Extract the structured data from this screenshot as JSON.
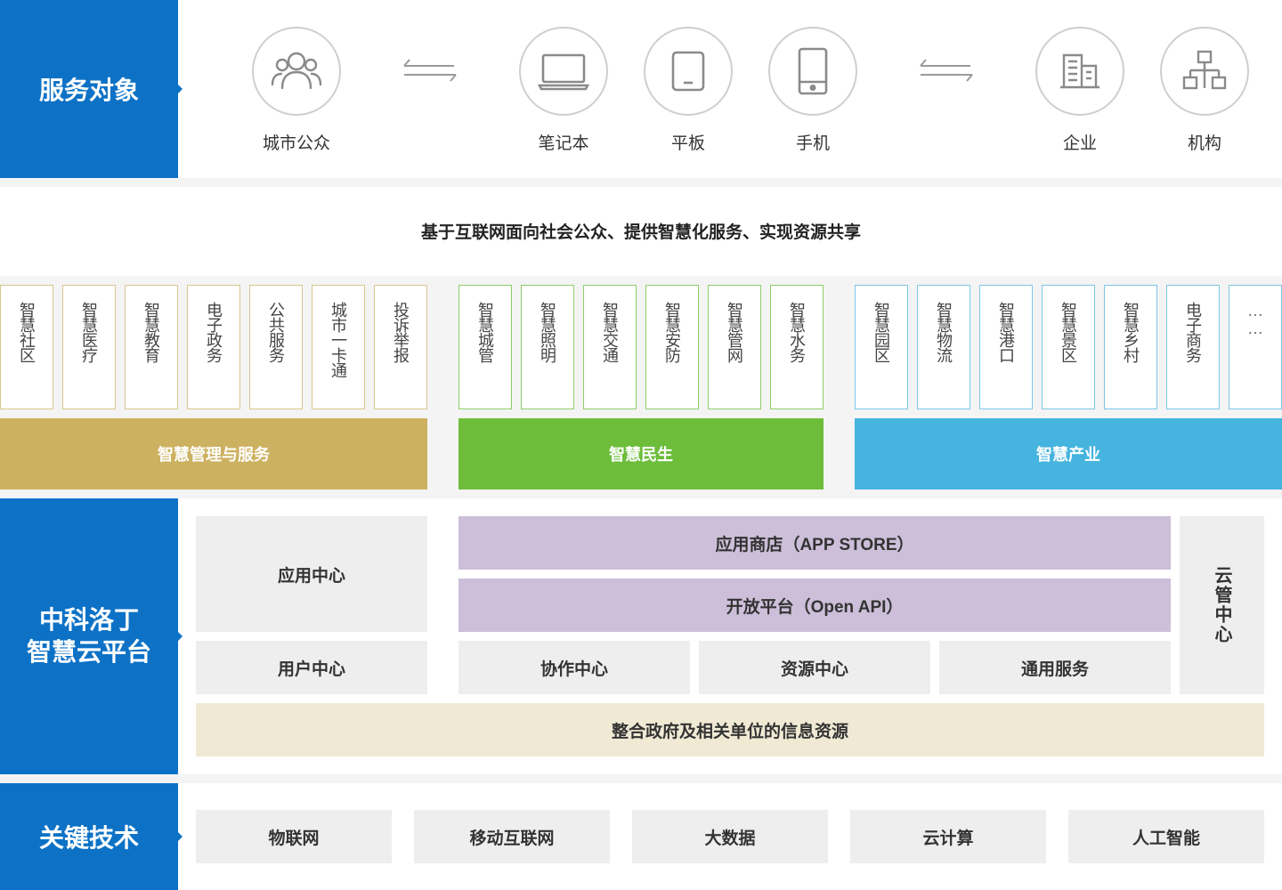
{
  "sections": {
    "service_objects": "服务对象",
    "platform": [
      "中科洛丁",
      "智慧云平台"
    ],
    "key_tech": "关键技术"
  },
  "service_targets": [
    {
      "label": "城市公众",
      "icon": "people-icon"
    },
    {
      "label": "笔记本",
      "icon": "laptop-icon"
    },
    {
      "label": "平板",
      "icon": "tablet-icon"
    },
    {
      "label": "手机",
      "icon": "phone-icon"
    },
    {
      "label": "企业",
      "icon": "building-icon"
    },
    {
      "label": "机构",
      "icon": "org-chart-icon"
    }
  ],
  "tagline": "基于互联网面向社会公众、提供智慧化服务、实现资源共享",
  "groups": [
    {
      "name": "智慧管理与服务",
      "color": "#ccb160",
      "border": "#d8c58a",
      "items": [
        "智慧社区",
        "智慧医疗",
        "智慧教育",
        "电子政务",
        "公共服务",
        "城市一卡通",
        "投诉举报"
      ]
    },
    {
      "name": "智慧民生",
      "color": "#6dbd3b",
      "border": "#8fcd6a",
      "items": [
        "智慧城管",
        "智慧照明",
        "智慧交通",
        "智慧安防",
        "智慧管网",
        "智慧水务"
      ]
    },
    {
      "name": "智慧产业",
      "color": "#45b4de",
      "border": "#7cc8e6",
      "items": [
        "智慧园区",
        "智慧物流",
        "智慧港口",
        "智慧景区",
        "智慧乡村",
        "电子商务",
        "……"
      ]
    }
  ],
  "platform": {
    "app_center": "应用中心",
    "user_center": "用户中心",
    "app_store": "应用商店（APP STORE）",
    "open_api": "开放平台（Open API）",
    "collab_center": "协作中心",
    "resource_center": "资源中心",
    "general_service": "通用服务",
    "cloud_mgmt": "云管中心",
    "integration": "整合政府及相关单位的信息资源"
  },
  "technologies": [
    "物联网",
    "移动互联网",
    "大数据",
    "云计算",
    "人工智能"
  ],
  "colors": {
    "blue": "#0d72c6",
    "purple": "#cdbfd9",
    "beige": "#f0ead5",
    "gray_box": "#eeeeee"
  }
}
